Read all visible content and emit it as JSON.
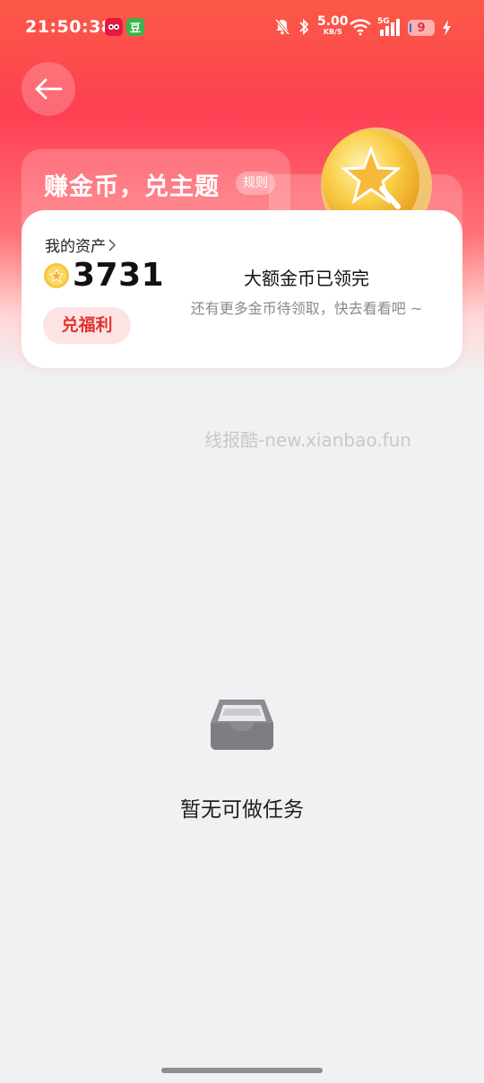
{
  "status_bar": {
    "time": "21:50:38",
    "app_icon_b": "豆",
    "speed_value": "5.00",
    "speed_unit": "KB/S",
    "network": "5G",
    "battery": "9",
    "icons": [
      "mute-bell-icon",
      "bluetooth-icon",
      "wifi-icon",
      "signal-icon",
      "battery-icon",
      "charging-icon"
    ]
  },
  "header": {
    "back_icon": "back-arrow-icon"
  },
  "banner": {
    "title": "赚金币，兑主题",
    "rules_label": "规则"
  },
  "asset_card": {
    "my_assets_label": "我的资产",
    "coin_count": "3731",
    "redeem_button_label": "兑福利",
    "claimed_title": "大额金币已领完",
    "claimed_subtitle": "还有更多金币待领取，快去看看吧 ~"
  },
  "watermark": "线报酷-new.xianbao.fun",
  "empty_state": {
    "icon": "empty-tray-icon",
    "message": "暂无可做任务"
  },
  "colors": {
    "accent_red": "#fd3f52",
    "redeem_bg": "#fde4e4",
    "redeem_text": "#e0342f",
    "page_bg": "#f0f1f3",
    "coin_gold": "#f6c53a"
  }
}
